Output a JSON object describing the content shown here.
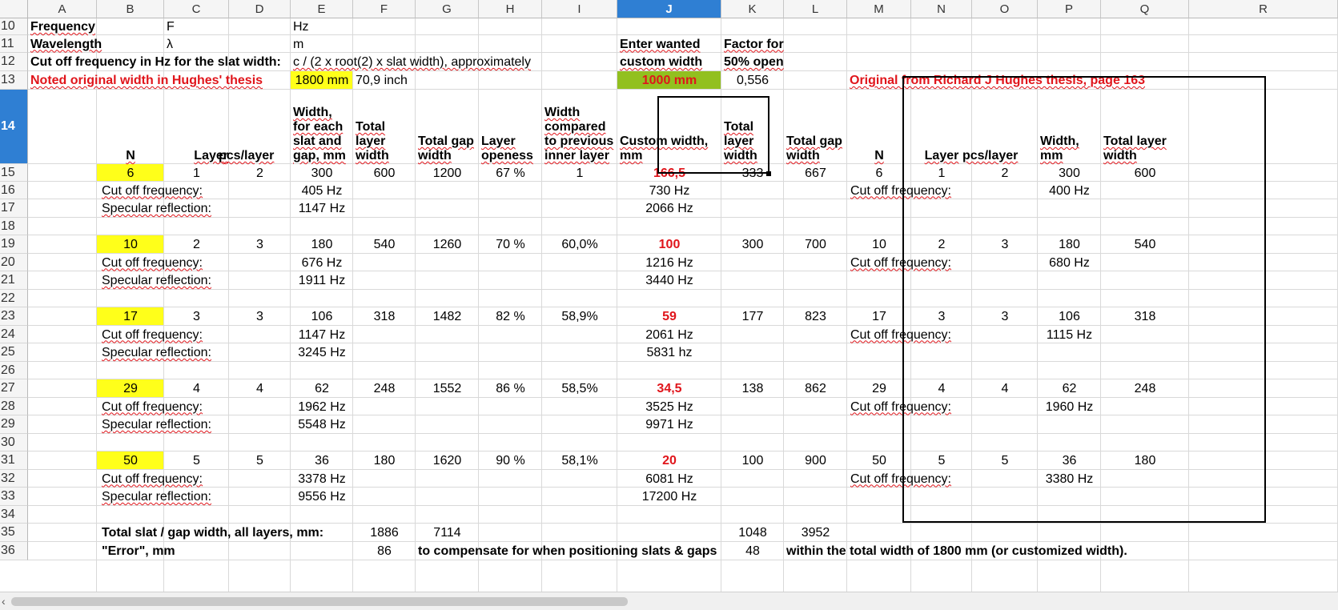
{
  "columns": [
    "A",
    "B",
    "C",
    "D",
    "E",
    "F",
    "G",
    "H",
    "I",
    "J",
    "K",
    "L",
    "M",
    "N",
    "O",
    "P",
    "Q",
    "R"
  ],
  "rows": [
    "10",
    "11",
    "12",
    "13",
    "14",
    "15",
    "16",
    "17",
    "18",
    "19",
    "20",
    "21",
    "22",
    "23",
    "24",
    "25",
    "26",
    "27",
    "28",
    "29",
    "30",
    "31",
    "32",
    "33",
    "34",
    "35",
    "36"
  ],
  "selected": {
    "column": "J",
    "row": "14"
  },
  "top": {
    "frequency_label": "Frequency",
    "frequency_symbol": "F",
    "frequency_unit": "Hz",
    "wavelength_label": "Wavelength",
    "wavelength_symbol": "λ",
    "wavelength_unit": "m",
    "cutoff_label": "Cut off frequency in Hz for the slat width:",
    "cutoff_formula": "c / (2 x root(2) x slat width), approximately",
    "noted_label": "Noted original width in Hughes' thesis",
    "noted_mm": "1800 mm",
    "noted_inch": "70,9 inch",
    "enter_wanted_1": "Enter wanted",
    "enter_wanted_2": "custom width",
    "custom_width_input": "1000 mm",
    "factor_1": "Factor for",
    "factor_2": "50% open",
    "factor_value": "0,556",
    "original_title": "Original from Richard J Hughes thesis, page 163"
  },
  "headers": {
    "N": "N",
    "layer": "Layer",
    "pcs": "pcs/layer",
    "width_l1": "Width,",
    "width_l2": "for each",
    "width_l3": "slat and",
    "width_l4": "gap, mm",
    "total_l1": "Total",
    "total_l2": "layer",
    "total_l3": "width",
    "gap_l1": "Total gap",
    "gap_l2": "width",
    "open_l1": "Layer",
    "open_l2": "openess",
    "cmp_l1": "Width",
    "cmp_l2": "compared",
    "cmp_l3": "to previous",
    "cmp_l4": "inner layer",
    "custom_l1": "Custom width,",
    "custom_l2": "mm",
    "ktotal_l1": "Total",
    "ktotal_l2": "layer",
    "ktotal_l3": "width",
    "kgap_l1": "Total gap",
    "kgap_l2": "width",
    "oN": "N",
    "oLayer": "Layer",
    "oPcs": "pcs/layer",
    "oWidth_l1": "Width,",
    "oWidth_l2": "mm",
    "oTotal_l1": "Total layer",
    "oTotal_l2": "width"
  },
  "labels": {
    "cutoff": "Cut off frequency:",
    "specular": "Specular reflection:"
  },
  "layers": [
    {
      "N": "6",
      "layer": "1",
      "pcs": "2",
      "width": "300",
      "total": "600",
      "gap": "1200",
      "open": "67 %",
      "cmp": "1",
      "custom": "166,5",
      "ktotal": "333",
      "kgap": "667",
      "cutoff": "405 Hz",
      "spec": "1147 Hz",
      "ccutoff": "730 Hz",
      "cspec": "2066 Hz",
      "oN": "6",
      "oLayer": "1",
      "oPcs": "2",
      "oWidth": "300",
      "oTotal": "600",
      "oCut": "400 Hz"
    },
    {
      "N": "10",
      "layer": "2",
      "pcs": "3",
      "width": "180",
      "total": "540",
      "gap": "1260",
      "open": "70 %",
      "cmp": "60,0%",
      "custom": "100",
      "ktotal": "300",
      "kgap": "700",
      "cutoff": "676 Hz",
      "spec": "1911 Hz",
      "ccutoff": "1216 Hz",
      "cspec": "3440 Hz",
      "oN": "10",
      "oLayer": "2",
      "oPcs": "3",
      "oWidth": "180",
      "oTotal": "540",
      "oCut": "680 Hz"
    },
    {
      "N": "17",
      "layer": "3",
      "pcs": "3",
      "width": "106",
      "total": "318",
      "gap": "1482",
      "open": "82 %",
      "cmp": "58,9%",
      "custom": "59",
      "ktotal": "177",
      "kgap": "823",
      "cutoff": "1147 Hz",
      "spec": "3245 Hz",
      "ccutoff": "2061 Hz",
      "cspec": "5831 hz",
      "oN": "17",
      "oLayer": "3",
      "oPcs": "3",
      "oWidth": "106",
      "oTotal": "318",
      "oCut": "1115 Hz"
    },
    {
      "N": "29",
      "layer": "4",
      "pcs": "4",
      "width": "62",
      "total": "248",
      "gap": "1552",
      "open": "86 %",
      "cmp": "58,5%",
      "custom": "34,5",
      "ktotal": "138",
      "kgap": "862",
      "cutoff": "1962 Hz",
      "spec": "5548 Hz",
      "ccutoff": "3525 Hz",
      "cspec": "9971 Hz",
      "oN": "29",
      "oLayer": "4",
      "oPcs": "4",
      "oWidth": "62",
      "oTotal": "248",
      "oCut": "1960 Hz"
    },
    {
      "N": "50",
      "layer": "5",
      "pcs": "5",
      "width": "36",
      "total": "180",
      "gap": "1620",
      "open": "90 %",
      "cmp": "58,1%",
      "custom": "20",
      "ktotal": "100",
      "kgap": "900",
      "cutoff": "3378 Hz",
      "spec": "9556 Hz",
      "ccutoff": "6081 Hz",
      "cspec": "17200 Hz",
      "oN": "50",
      "oLayer": "5",
      "oPcs": "5",
      "oWidth": "36",
      "oTotal": "180",
      "oCut": "3380 Hz"
    }
  ],
  "totals": {
    "label": "Total slat / gap width, all layers, mm:",
    "f": "1886",
    "g": "7114",
    "k": "1048",
    "l": "3952",
    "error_label": "\"Error\", mm",
    "error_f": "86",
    "error_note": "to compensate for when positioning slats & gaps",
    "error_k": "48",
    "error_note2": "within the total width of 1800 mm (or customized width)."
  },
  "colors": {
    "accent_red": "#e0151b",
    "highlight_yellow": "#ffff1a",
    "input_green": "#92c01f",
    "selection_blue": "#2f7fd3"
  }
}
